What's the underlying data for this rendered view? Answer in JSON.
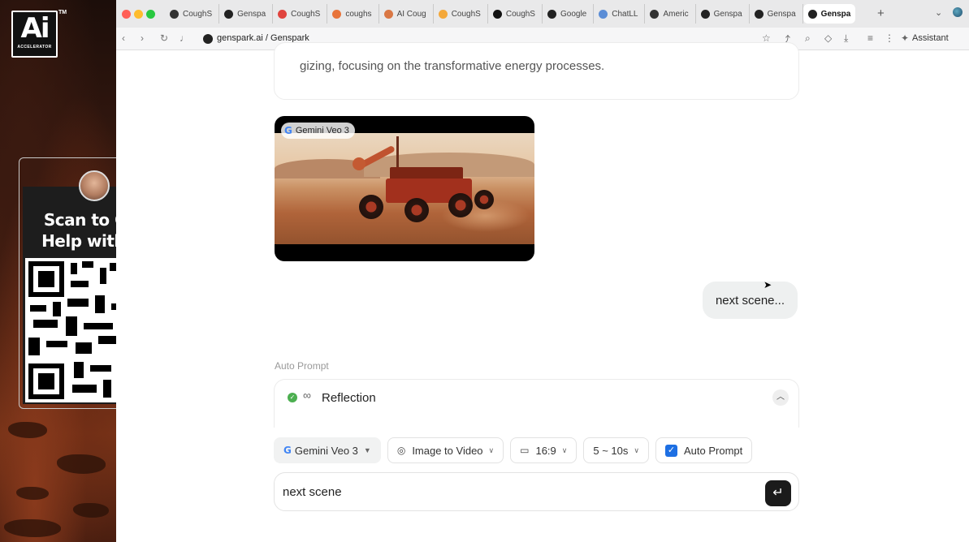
{
  "overlay": {
    "logo_text": "Ai",
    "logo_subtext": "ACCELERATOR",
    "logo_tm": "TM",
    "scan_line1": "Scan to Get",
    "scan_line2": "Help with Ai"
  },
  "browser": {
    "tabs": [
      {
        "label": "CoughS",
        "icon": "openai-icon",
        "color": "#333333"
      },
      {
        "label": "Genspa",
        "icon": "genspark-icon",
        "color": "#222222"
      },
      {
        "label": "CoughS",
        "icon": "target-icon",
        "color": "#e0443e"
      },
      {
        "label": "coughs",
        "icon": "colorful-icon",
        "color": "#e8743b"
      },
      {
        "label": "AI Coug",
        "icon": "spark-icon",
        "color": "#d97744"
      },
      {
        "label": "CoughS",
        "icon": "arrow-icon",
        "color": "#f4a83a"
      },
      {
        "label": "CoughS",
        "icon": "dot-icon",
        "color": "#111111"
      },
      {
        "label": "Google",
        "icon": "google-icon",
        "color": "#222222"
      },
      {
        "label": "ChatLL",
        "icon": "chatllm-icon",
        "color": "#5b8dd6"
      },
      {
        "label": "Americ",
        "icon": "openai-icon",
        "color": "#333333"
      },
      {
        "label": "Genspa",
        "icon": "genspark-icon",
        "color": "#222222"
      },
      {
        "label": "Genspa",
        "icon": "genspark-icon",
        "color": "#222222"
      },
      {
        "label": "Genspa",
        "icon": "genspark-icon",
        "color": "#222222",
        "active": true
      }
    ],
    "new_tab": "+",
    "url": "genspark.ai / Genspark",
    "assistant_label": "Assistant"
  },
  "chat": {
    "previous_text": "gizing, focusing on the transformative energy processes.",
    "video_badge": "Gemini Veo 3",
    "user_message": "next scene...",
    "auto_prompt_label": "Auto Prompt",
    "reflection_title": "Reflection"
  },
  "options": {
    "model": "Gemini Veo 3",
    "mode": "Image to Video",
    "aspect": "16:9",
    "duration": "5 ~ 10s",
    "auto_prompt": "Auto Prompt",
    "auto_prompt_checked": true
  },
  "input": {
    "value": "next scene"
  },
  "colors": {
    "accent": "#1d6fe3",
    "send_button": "#1b1b1b",
    "success": "#4caf50"
  }
}
